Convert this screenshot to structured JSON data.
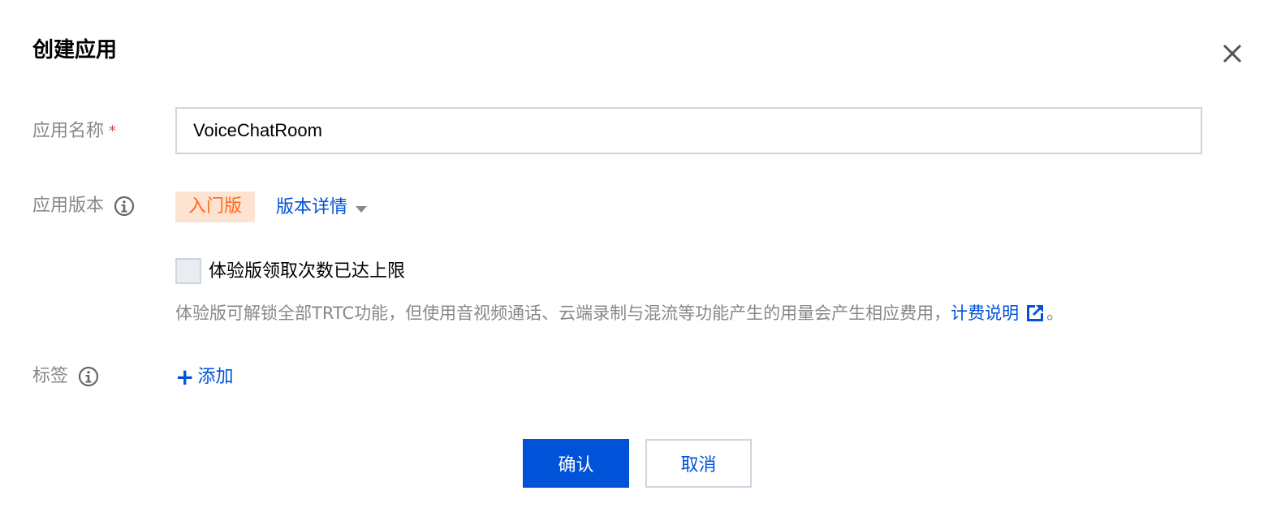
{
  "dialog": {
    "title": "创建应用",
    "close_icon": "close-icon"
  },
  "form": {
    "app_name_label": "应用名称",
    "required_mark": "*",
    "app_name_value": "VoiceChatRoom",
    "app_version_label": "应用版本",
    "version_badge": "入门版",
    "version_detail_link": "版本详情",
    "trial_checkbox_label": "体验版领取次数已达上限",
    "trial_checkbox_checked": false,
    "trial_description": "体验版可解锁全部TRTC功能，但使用音视频通话、云端录制与混流等功能产生的用量会产生相应费用，",
    "billing_link": "计费说明",
    "description_end": "。",
    "tags_label": "标签",
    "add_tag_plus": "+",
    "add_tag_label": "添加"
  },
  "footer": {
    "confirm_label": "确认",
    "cancel_label": "取消"
  },
  "colors": {
    "primary": "#0052d9",
    "badge_bg": "#fde3d1",
    "badge_text": "#ff6a1a",
    "required": "#e54545"
  }
}
